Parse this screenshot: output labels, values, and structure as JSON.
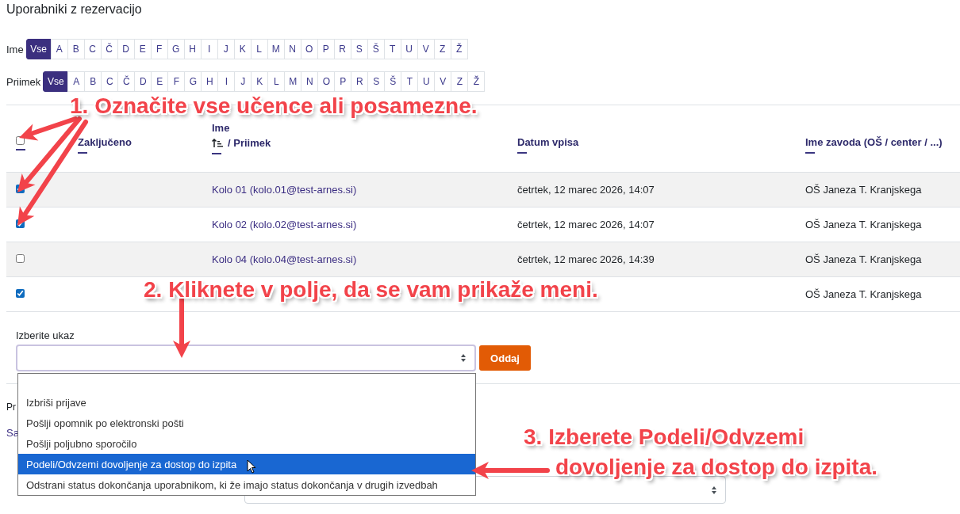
{
  "page_title": "Uporabniki z rezervacijo",
  "filters": [
    {
      "label": "Ime",
      "letters": [
        {
          "text": "Vse",
          "selected": true
        },
        {
          "text": "A",
          "selected": false
        },
        {
          "text": "B",
          "selected": false
        },
        {
          "text": "C",
          "selected": false
        },
        {
          "text": "Č",
          "selected": false
        },
        {
          "text": "D",
          "selected": false
        },
        {
          "text": "E",
          "selected": false
        },
        {
          "text": "F",
          "selected": false
        },
        {
          "text": "G",
          "selected": false
        },
        {
          "text": "H",
          "selected": false
        },
        {
          "text": "I",
          "selected": false
        },
        {
          "text": "J",
          "selected": false
        },
        {
          "text": "K",
          "selected": false
        },
        {
          "text": "L",
          "selected": false
        },
        {
          "text": "M",
          "selected": false
        },
        {
          "text": "N",
          "selected": false
        },
        {
          "text": "O",
          "selected": false
        },
        {
          "text": "P",
          "selected": false
        },
        {
          "text": "R",
          "selected": false
        },
        {
          "text": "S",
          "selected": false
        },
        {
          "text": "Š",
          "selected": false
        },
        {
          "text": "T",
          "selected": false
        },
        {
          "text": "U",
          "selected": false
        },
        {
          "text": "V",
          "selected": false
        },
        {
          "text": "Z",
          "selected": false
        },
        {
          "text": "Ž",
          "selected": false
        }
      ]
    },
    {
      "label": "Priimek",
      "letters": [
        {
          "text": "Vse",
          "selected": true
        },
        {
          "text": "A",
          "selected": false
        },
        {
          "text": "B",
          "selected": false
        },
        {
          "text": "C",
          "selected": false
        },
        {
          "text": "Č",
          "selected": false
        },
        {
          "text": "D",
          "selected": false
        },
        {
          "text": "E",
          "selected": false
        },
        {
          "text": "F",
          "selected": false
        },
        {
          "text": "G",
          "selected": false
        },
        {
          "text": "H",
          "selected": false
        },
        {
          "text": "I",
          "selected": false
        },
        {
          "text": "J",
          "selected": false
        },
        {
          "text": "K",
          "selected": false
        },
        {
          "text": "L",
          "selected": false
        },
        {
          "text": "M",
          "selected": false
        },
        {
          "text": "N",
          "selected": false
        },
        {
          "text": "O",
          "selected": false
        },
        {
          "text": "P",
          "selected": false
        },
        {
          "text": "R",
          "selected": false
        },
        {
          "text": "S",
          "selected": false
        },
        {
          "text": "Š",
          "selected": false
        },
        {
          "text": "T",
          "selected": false
        },
        {
          "text": "U",
          "selected": false
        },
        {
          "text": "V",
          "selected": false
        },
        {
          "text": "Z",
          "selected": false
        },
        {
          "text": "Ž",
          "selected": false
        }
      ]
    }
  ],
  "table": {
    "select_all": {
      "checked": false
    },
    "columns": [
      {
        "label": "Zaključeno",
        "sorted": false
      },
      {
        "top": "Ime",
        "label": "/ Priimek",
        "sorted": true
      },
      {
        "label": "Datum vpisa",
        "sorted": false
      },
      {
        "label": "Ime zavoda (OŠ / center / ...)",
        "sorted": false
      }
    ],
    "rows": [
      {
        "checked": true,
        "name": "Kolo 01 (kolo.01@test-arnes.si)",
        "date": "četrtek, 12 marec 2026, 14:07",
        "institution": "OŠ Janeza T. Kranjskega"
      },
      {
        "checked": true,
        "name": "Kolo 02 (kolo.02@test-arnes.si)",
        "date": "četrtek, 12 marec 2026, 14:07",
        "institution": "OŠ Janeza T. Kranjskega"
      },
      {
        "checked": false,
        "name": "Kolo 04 (kolo.04@test-arnes.si)",
        "date": "četrtek, 12 marec 2026, 14:39",
        "institution": "OŠ Janeza T. Kranjskega"
      },
      {
        "checked": true,
        "institution": "OŠ Janeza T. Kranjskega"
      }
    ]
  },
  "bulk_action": {
    "label": "Izberite ukaz",
    "submit": "Oddaj",
    "options": [
      {
        "text": "Izbriši prijave",
        "selected": false
      },
      {
        "text": "Pošlji opomnik po elektronski pošti",
        "selected": false
      },
      {
        "text": "Pošlji poljubno sporočilo",
        "selected": false
      },
      {
        "text": "Podeli/Odvzemi dovoljenje za dostop do izpita",
        "selected": true
      },
      {
        "text": "Odstrani status dokončanja uporabnikom, ki že imajo status dokončanja v drugih izvedbah",
        "selected": false
      }
    ]
  },
  "below": {
    "heading": "Pr",
    "link": "Sa"
  },
  "annotations": [
    {
      "lines": [
        "1. Označite vse učence ali posamezne."
      ]
    },
    {
      "lines": [
        "2. Kliknete v polje, da se vam prikaže meni."
      ]
    },
    {
      "lines": [
        "3. Izberete Podeli/Odvzemi",
        "dovoljenje za dostop do izpita."
      ]
    }
  ]
}
